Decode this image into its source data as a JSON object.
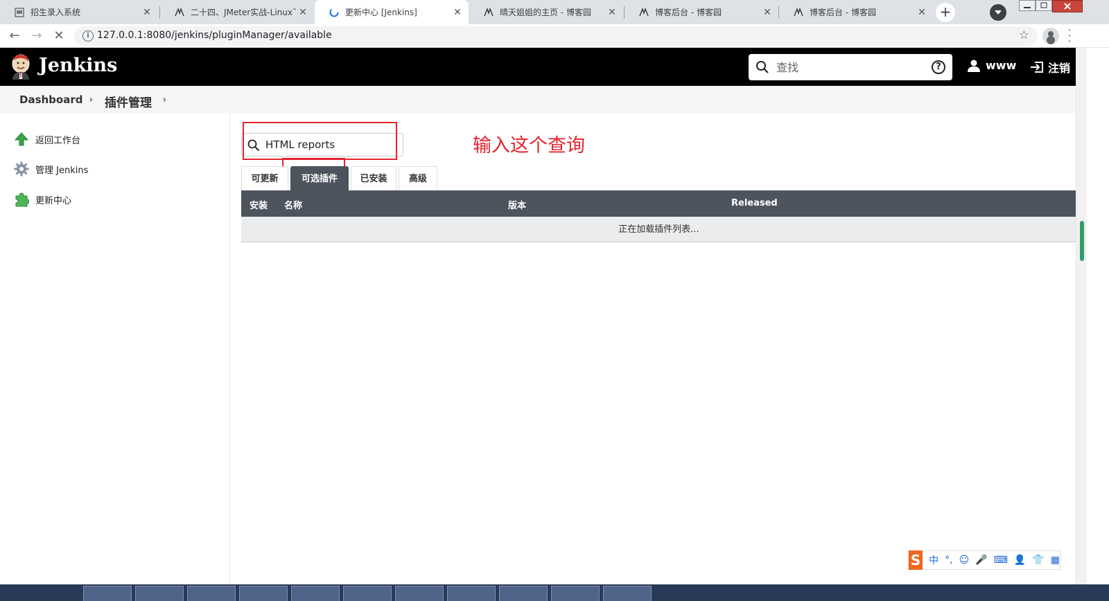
{
  "browser": {
    "tabs": [
      {
        "title": "招生录入系统",
        "icon": "page-icon",
        "active": false
      },
      {
        "title": "二十四、JMeter实战-Linux下",
        "icon": "cnblogs-icon",
        "active": false
      },
      {
        "title": "更新中心 [Jenkins]",
        "icon": "loading-icon",
        "active": true
      },
      {
        "title": "晴天姐姐的主页 - 博客园",
        "icon": "cnblogs-icon",
        "active": false
      },
      {
        "title": "博客后台 - 博客园",
        "icon": "cnblogs-icon",
        "active": false
      },
      {
        "title": "博客后台 - 博客园",
        "icon": "cnblogs-icon",
        "active": false
      }
    ],
    "url": "127.0.0.1:8080/jenkins/pluginManager/available"
  },
  "header": {
    "brand": "Jenkins",
    "search_placeholder": "查找",
    "user": "www",
    "logout": "注销"
  },
  "breadcrumb": {
    "items": [
      "Dashboard",
      "插件管理"
    ]
  },
  "sidebar": {
    "items": [
      {
        "label": "返回工作台",
        "icon": "arrow-up-icon"
      },
      {
        "label": "管理 Jenkins",
        "icon": "gear-icon"
      },
      {
        "label": "更新中心",
        "icon": "puzzle-icon"
      }
    ]
  },
  "main": {
    "filter_value": "HTML reports",
    "annotation": "输入这个查询",
    "tabs": [
      {
        "label": "可更新",
        "active": false
      },
      {
        "label": "可选插件",
        "active": true
      },
      {
        "label": "已安装",
        "active": false
      },
      {
        "label": "高级",
        "active": false
      }
    ],
    "table": {
      "columns": [
        "安装",
        "名称",
        "版本",
        "Released"
      ],
      "loading_text": "正在加载插件列表..."
    }
  },
  "ime": {
    "items": [
      "中",
      "°,",
      "☺",
      "🎤",
      "⌨",
      "👤",
      "👕",
      "▦"
    ]
  },
  "colors": {
    "header_bg": "#000000",
    "table_header_bg": "#4d545d",
    "annotation_red": "#e5232e"
  }
}
